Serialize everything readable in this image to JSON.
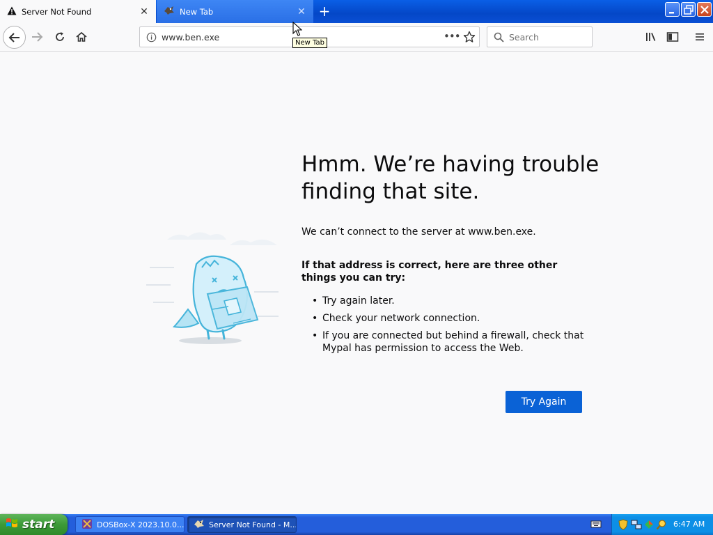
{
  "tabs": [
    {
      "label": "Server Not Found",
      "active": true
    },
    {
      "label": "New Tab",
      "active": false
    }
  ],
  "tooltip": "New Tab",
  "navbar": {
    "url": "www.ben.exe",
    "search_placeholder": "Search"
  },
  "error_page": {
    "title": "Hmm. We’re having trouble finding that site.",
    "description": "We can’t connect to the server at www.ben.exe.",
    "suggest_heading": "If that address is correct, here are three other things you can try:",
    "suggestions": [
      "Try again later.",
      "Check your network connection.",
      "If you are connected but behind a firewall, check that Mypal has permission to access the Web."
    ],
    "try_again_label": "Try Again"
  },
  "taskbar": {
    "start_label": "start",
    "items": [
      {
        "label": "DOSBox-X 2023.10.0..."
      },
      {
        "label": "Server Not Found - M..."
      }
    ],
    "clock": "6:47 AM"
  },
  "colors": {
    "accent": "#0a62d6",
    "titlebar": "#0447c7",
    "taskbar": "#245edb",
    "start": "#3c9a37"
  }
}
